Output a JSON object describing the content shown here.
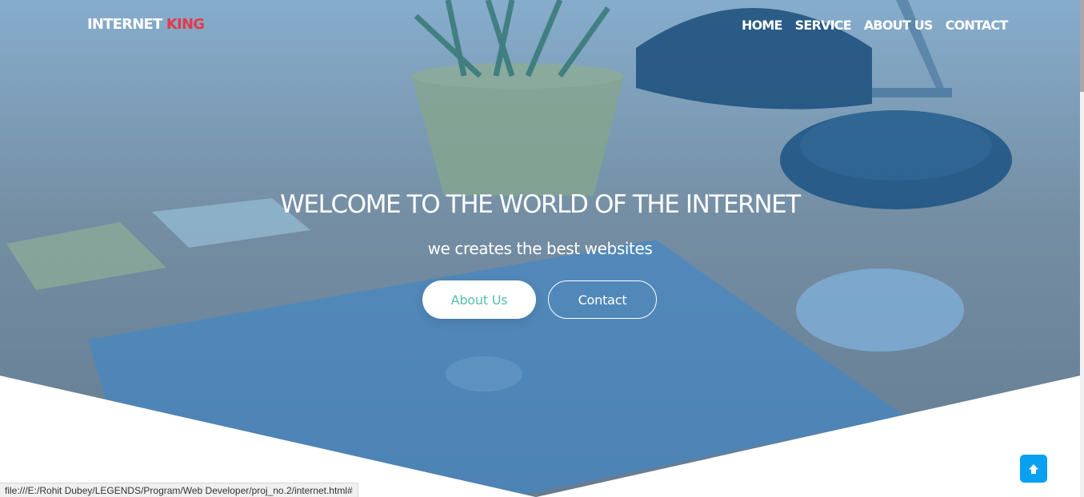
{
  "brand": {
    "first": "INTERNET",
    "second": "KING"
  },
  "nav": {
    "items": [
      "HOME",
      "SERVICE",
      "ABOUT US",
      "CONTACT"
    ]
  },
  "hero": {
    "title": "WELCOME TO THE WORLD OF THE INTERNET",
    "subtitle": "we creates the best websites",
    "primary_button": "About Us",
    "secondary_button": "Contact"
  },
  "statusbar": {
    "url": "file:///E:/Rohit Dubey/LEGENDS/Program/Web Developer/proj_no.2/internet.html#"
  },
  "icons": {
    "scroll_top": "arrow-up-icon"
  },
  "colors": {
    "brand_accent": "#e33a48",
    "primary_button_text": "#53c2a4",
    "scroll_top_bg": "#0aa0f0",
    "hero_overlay": "#4485bc"
  }
}
